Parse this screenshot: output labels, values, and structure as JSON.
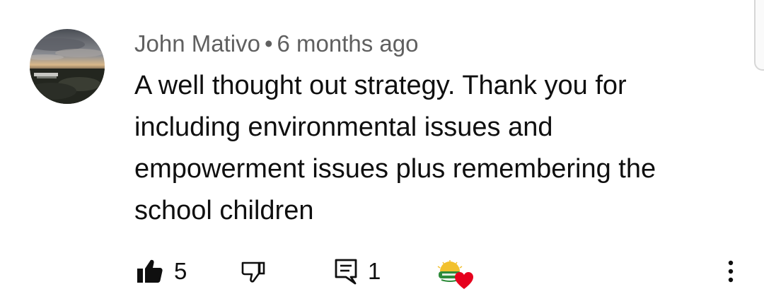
{
  "comment": {
    "author": "John Mativo",
    "separator": "•",
    "timestamp": "6 months ago",
    "text": "A well thought out strategy. Thank you for including environmental issues and empowerment issues plus remembering the school children"
  },
  "actions": {
    "like_count": "5",
    "reply_count": "1"
  },
  "icons": {
    "like": "thumbs-up-filled-icon",
    "dislike": "thumbs-down-outline-icon",
    "reply": "reply-comment-icon",
    "heart": "creator-heart-icon",
    "more": "more-vertical-icon"
  },
  "colors": {
    "text_primary": "#0f0f0f",
    "text_secondary": "#606060",
    "heart": "#e6001d",
    "creator_logo_green": "#2e8b3a",
    "creator_logo_sun": "#f2c12e"
  }
}
